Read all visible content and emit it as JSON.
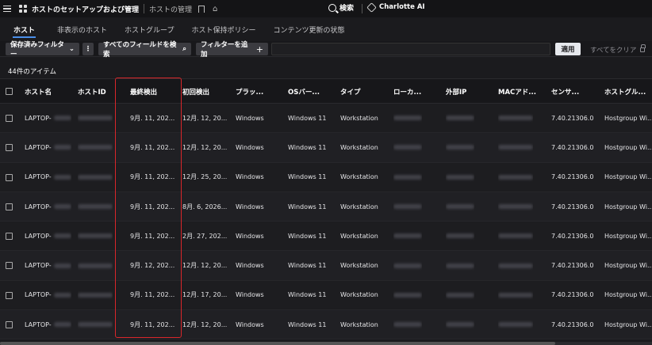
{
  "topbar": {
    "title": "ホストのセットアップおよび管理",
    "subtitle": "ホストの管理",
    "search_label": "検索",
    "ai_label": "Charlotte AI"
  },
  "tabs": [
    {
      "label": "ホスト",
      "active": true
    },
    {
      "label": "非表示のホスト",
      "active": false
    },
    {
      "label": "ホストグループ",
      "active": false
    },
    {
      "label": "ホスト保持ポリシー",
      "active": false
    },
    {
      "label": "コンテンツ更新の状態",
      "active": false
    }
  ],
  "filterbar": {
    "saved_filters": "保存済みフィルター",
    "search_fields": "すべてのフィールドを検索",
    "add_filter": "フィルターを追加",
    "apply": "適用",
    "clear_all": "すべてをクリア"
  },
  "item_count": "44件のアイテム",
  "columns": [
    "ホスト名",
    "ホストID",
    "最終検出",
    "初回検出",
    "プラッ...",
    "OSバー...",
    "タイプ",
    "ローカ...",
    "外部IP",
    "MACアド...",
    "センサ...",
    "ホストグル..."
  ],
  "rows": [
    {
      "hostname": "LAPTOP-",
      "last_seen": "9月. 11, 202...",
      "first_seen": "12月. 12, 20...",
      "platform": "Windows",
      "os": "Windows 11",
      "type": "Workstation",
      "sensor": "7.40.21306.0",
      "group": "Hostgroup Wi..."
    },
    {
      "hostname": "LAPTOP-",
      "last_seen": "9月. 11, 202...",
      "first_seen": "12月. 12, 20...",
      "platform": "Windows",
      "os": "Windows 11",
      "type": "Workstation",
      "sensor": "7.40.21306.0",
      "group": "Hostgroup Wi..."
    },
    {
      "hostname": "LAPTOP-",
      "last_seen": "9月. 11, 202...",
      "first_seen": "12月. 25, 20...",
      "platform": "Windows",
      "os": "Windows 11",
      "type": "Workstation",
      "sensor": "7.40.21306.0",
      "group": "Hostgroup Wi..."
    },
    {
      "hostname": "LAPTOP-",
      "last_seen": "9月. 11, 202...",
      "first_seen": "8月. 6, 2026...",
      "platform": "Windows",
      "os": "Windows 11",
      "type": "Workstation",
      "sensor": "7.40.21306.0",
      "group": "Hostgroup Wi..."
    },
    {
      "hostname": "LAPTOP-",
      "last_seen": "9月. 11, 202...",
      "first_seen": "2月. 27, 202...",
      "platform": "Windows",
      "os": "Windows 11",
      "type": "Workstation",
      "sensor": "7.40.21306.0",
      "group": "Hostgroup Wi..."
    },
    {
      "hostname": "LAPTOP-",
      "last_seen": "9月. 12, 202...",
      "first_seen": "12月. 12, 20...",
      "platform": "Windows",
      "os": "Windows 11",
      "type": "Workstation",
      "sensor": "7.40.21306.0",
      "group": "Hostgroup Wi..."
    },
    {
      "hostname": "LAPTOP-",
      "last_seen": "9月. 11, 202...",
      "first_seen": "12月. 17, 20...",
      "platform": "Windows",
      "os": "Windows 11",
      "type": "Workstation",
      "sensor": "7.40.21306.0",
      "group": "Hostgroup Wi..."
    },
    {
      "hostname": "LAPTOP-",
      "last_seen": "9月. 11, 202...",
      "first_seen": "12月. 12, 20...",
      "platform": "Windows",
      "os": "Windows 11",
      "type": "Workstation",
      "sensor": "7.40.21306.0",
      "group": "Hostgroup Wi..."
    }
  ],
  "colors": {
    "accent": "#4a8ee8",
    "highlight": "#d9262a"
  }
}
